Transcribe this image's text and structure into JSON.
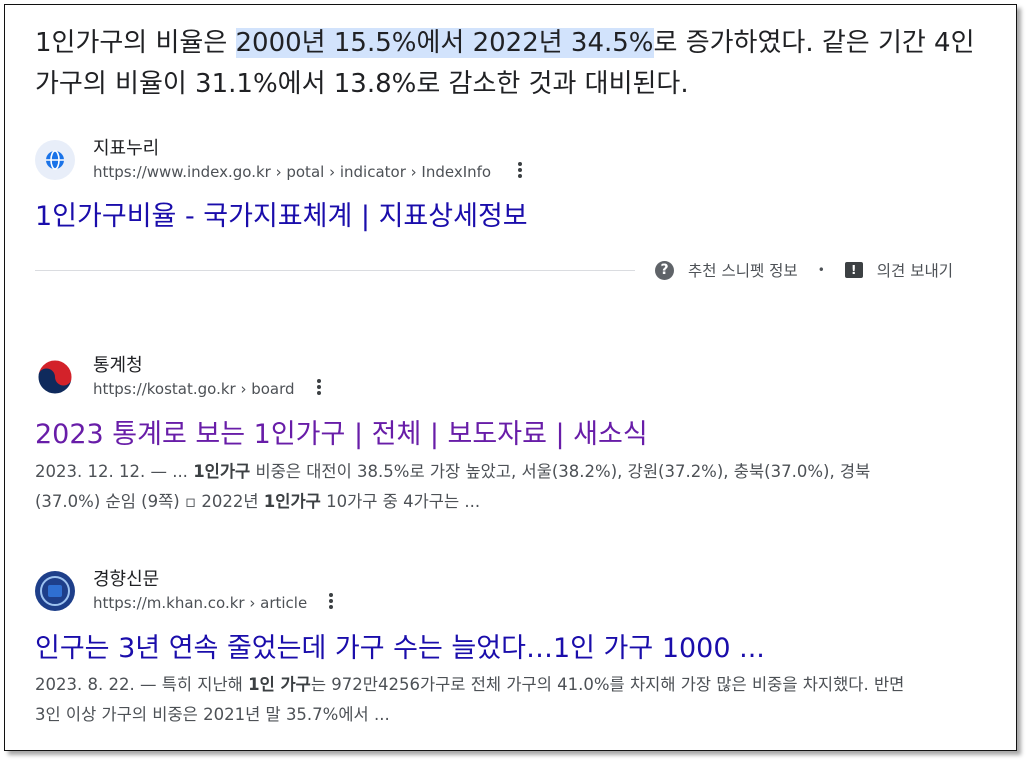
{
  "snippet": {
    "t1": "1인가구의 비율은 ",
    "highlight": "2000년 15.5%에서 2022년 34.5%",
    "t2": "로 증가하였다. 같은 기간 4인가구의 비율이 31.1%에서 13.8%로 감소한 것과 대비된다."
  },
  "featured": {
    "site_name": "지표누리",
    "url": "https://www.index.go.kr › potal › indicator › IndexInfo",
    "title": "1인가구비율 - 국가지표체계 | 지표상세정보"
  },
  "snippet_footer": {
    "about_label": "추천 스니펫 정보",
    "separator": "•",
    "feedback_label": "의견 보내기"
  },
  "results": [
    {
      "site_name": "통계청",
      "url": "https://kostat.go.kr › board",
      "title": "2023 통계로 보는 1인가구 | 전체 | 보도자료 | 새소식",
      "date": "2023. 12. 12. — ... ",
      "d1": "1인가구",
      "d2": " 비중은 대전이 38.5%로 가장 높았고, 서울(38.2%), 강원(37.2%), 충북(37.0%), 경북(37.0%) 순임 (9쪽) ▫ 2022년 ",
      "d3": "1인가구",
      "d4": " 10가구 중 4가구는 ..."
    },
    {
      "site_name": "경향신문",
      "url": "https://m.khan.co.kr › article",
      "title": "인구는 3년 연속 줄었는데 가구 수는 늘었다…1인 가구 1000 ...",
      "date": "2023. 8. 22. — 특히 지난해 ",
      "d1": "1인 가구",
      "d2": "는 972만4256가구로 전체 가구의 41.0%를 차지해 가장 많은 비중을 차지했다. 반면 3인 이상 가구의 비중은 2021년 말 35.7%에서 ..."
    }
  ],
  "icons": {
    "index_favicon": "globe-icon",
    "kostat_favicon": "taegeuk-icon",
    "khan_favicon": "khan-logo-icon",
    "more": "more-vert-icon",
    "help": "question-circle-icon",
    "feedback": "feedback-icon"
  },
  "colors": {
    "link_unvisited": "#1a0dab",
    "link_visited": "#681da8",
    "highlight": "#d2e3fc"
  }
}
